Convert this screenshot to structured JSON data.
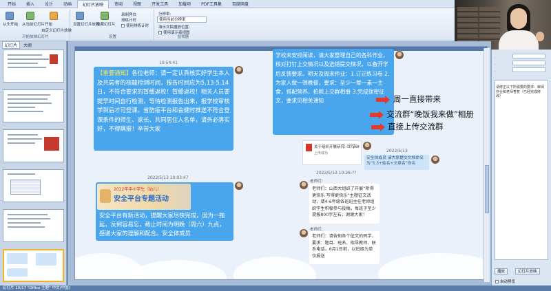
{
  "ribbon": {
    "tabs": [
      "开始",
      "插入",
      "设计",
      "动画",
      "幻灯片放映",
      "审阅",
      "视图",
      "开发工具",
      "加载项",
      "PDF工具集",
      "百度网盘"
    ],
    "groups": {
      "start": {
        "label": "开始放映幻灯片",
        "items": [
          "从头开始",
          "从当前幻灯片开始",
          "自定义幻灯片放映"
        ]
      },
      "setup": {
        "label": "设置",
        "items": [
          "设置幻灯片放映",
          "隐藏幻灯片",
          "录制旁白",
          "排练计时",
          "使用排练计时"
        ]
      },
      "monitor": {
        "label": "监视器",
        "items": [
          "分辨率:",
          "使用当前分辨率",
          "演示文稿播放位置:",
          "使用演示者视图"
        ]
      }
    }
  },
  "left_panel": {
    "tabs": [
      "幻灯片",
      "大纲"
    ]
  },
  "slide": {
    "timestamps": [
      "10:54:41",
      "2022/5/13 10:03:47",
      "2022/5/13",
      "2022/5/13 10:26:??"
    ],
    "bubble_notice": {
      "tag": "【重要通知】",
      "text": "各位老师：请一定认真核实好学生本人及共居者的核酸检测时间，报告时间应为5.13-5.14日，不符合要求的暂缓返校！暂缓返校！相关人员要提早时间自行检测，等待检测报告出来，报学校审核学到后才可登课。省防疫平台和会健时推送不符合登课条件的师生、家长、共同居住人名单，请务必落实好，不得瞒报！辛苦大家"
    },
    "bubble_safety": {
      "poster_title": "2022年中小学生（幼儿）",
      "poster_banner": "安全平台专题活动",
      "text": "安全平台有新活动，提醒大家尽快完成，因为一拖延，反倒容易忘，截止时间为明晚（周六）九点，感谢大家的理解和配合。安全体成员"
    },
    "bubble_homework": "学校未安排阅读，请大家整理自己的各科作业，核对打钉上交情况以及选错提交情况，以备开学后反馈要求。明天及周末作业：1.订正练习卷  2.为家人做一顿晚餐，要求：至少一荤一素一主食，搭配营养，拍照上交群相册  3.完成保密征文，要求见相关通知",
    "file_card": {
      "name": "关于组织开展研究...1).pdf",
      "size": "(1.22MB)",
      "source": "上传成功"
    },
    "bubble_reminder": "安全体成员 请大家提交文档命名为“5.3+姓名+文章名”命名",
    "group_msg1": {
      "name": "老师们：",
      "text": "老师们：山西大组织了开展“听得更快乐 写得更快乐”主题征文活动，请4-6年级各班班主任老师组织学生积极参与投稿，每班子至少提报800字左右，谢谢大家！"
    },
    "group_msg2": {
      "name": "老师们：",
      "text": "老师们：请告知各个征文的同学，要求：题目、班名、指导教师、联系电话，6月1日前，以班级为单位报送"
    },
    "annotations": [
      "周一直接带来",
      "交流群“晚饭我来做”相册",
      "直接上传交流群"
    ]
  },
  "right_panel": {
    "note": "请修正以下所需要的要求：审阅作业和老师答复（已经完成修改）",
    "buttons": [
      "播放",
      "幻灯片放映"
    ],
    "checkbox_label": "自动预览"
  },
  "statusbar": {
    "text": "幻灯片 10/17   \"Office 主题\"   中文(中国)"
  }
}
